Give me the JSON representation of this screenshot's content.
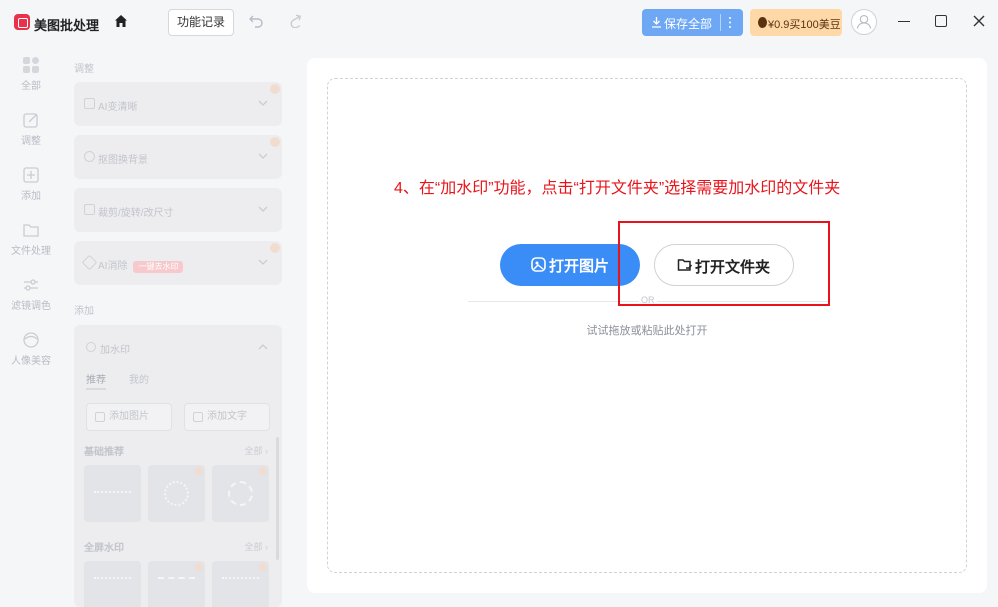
{
  "header": {
    "app_title": "美图批处理",
    "history_label": "功能记录",
    "save_label": "保存全部",
    "promo_label": "¥0.9买100美豆"
  },
  "nav": [
    {
      "label": "全部",
      "icon": "grid-icon"
    },
    {
      "label": "调整",
      "icon": "edit-icon"
    },
    {
      "label": "添加",
      "icon": "add-icon"
    },
    {
      "label": "文件处理",
      "icon": "folder-icon"
    },
    {
      "label": "滤镜调色",
      "icon": "sliders-icon"
    },
    {
      "label": "人像美容",
      "icon": "face-icon"
    }
  ],
  "panel": {
    "adjust_section": "调整",
    "cards": [
      {
        "title": "AI变清晰"
      },
      {
        "title": "抠图换背景"
      },
      {
        "title": "裁剪/旋转/改尺寸"
      },
      {
        "title": "AI消除",
        "tag": "一键去水印"
      }
    ],
    "add_section": "添加",
    "watermark": {
      "title": "加水印",
      "tabs": [
        "推荐",
        "我的"
      ],
      "add_image": "添加图片",
      "add_text": "添加文字",
      "group1": "基础推荐",
      "group2": "全屏水印",
      "all_label": "全部 ›"
    }
  },
  "main": {
    "instruction": "4、在“加水印”功能，点击“打开文件夹”选择需要加水印的文件夹",
    "open_image": "打开图片",
    "open_folder": "打开文件夹",
    "or_text": "OR",
    "hint": "试试拖放或粘贴此处打开"
  },
  "colors": {
    "primary": "#3a8cf7",
    "save_button": "#6ea8f5",
    "promo": "#ffd8a8",
    "annotation_red": "#e8141b"
  }
}
